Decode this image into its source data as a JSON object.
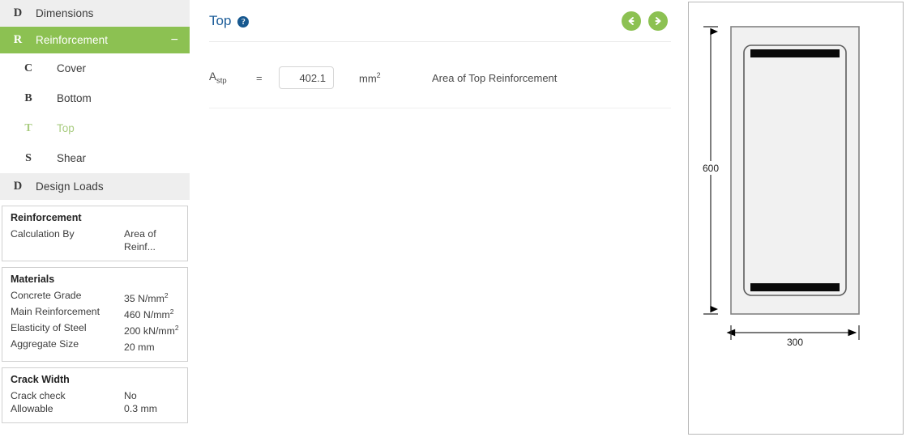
{
  "sidebar": {
    "sections": [
      {
        "letter": "D",
        "label": "Dimensions",
        "active": false,
        "collapse": ""
      },
      {
        "letter": "R",
        "label": "Reinforcement",
        "active": true,
        "collapse": "−"
      }
    ],
    "items": [
      {
        "letter": "C",
        "label": "Cover",
        "selected": false
      },
      {
        "letter": "B",
        "label": "Bottom",
        "selected": false
      },
      {
        "letter": "T",
        "label": "Top",
        "selected": true
      },
      {
        "letter": "S",
        "label": "Shear",
        "selected": false
      }
    ],
    "design_loads": {
      "letter": "D",
      "label": "Design Loads"
    },
    "panels": [
      {
        "title": "Reinforcement",
        "rows": [
          {
            "key": "Calculation By",
            "value": "Area of Reinf..."
          }
        ]
      },
      {
        "title": "Materials",
        "rows": [
          {
            "key": "Concrete Grade",
            "value": "35 N/mm",
            "sup": "2"
          },
          {
            "key": "Main Reinforcement",
            "value": "460 N/mm",
            "sup": "2"
          },
          {
            "key": "Elasticity of Steel",
            "value": "200 kN/mm",
            "sup": "2"
          },
          {
            "key": "Aggregate Size",
            "value": "20 mm",
            "sup": ""
          }
        ]
      },
      {
        "title": "Crack Width",
        "rows": [
          {
            "key": "Crack check",
            "value": "No",
            "sup": ""
          },
          {
            "key": "Allowable",
            "value": "0.3 mm",
            "sup": ""
          }
        ]
      }
    ]
  },
  "main": {
    "title": "Top",
    "help_label": "?",
    "prev_label": "Previous",
    "next_label": "Next",
    "field": {
      "symbol": "A",
      "symbol_sub": "stp",
      "equals": "=",
      "value": "402.1",
      "placeholder": "",
      "unit": "mm",
      "unit_sup": "2",
      "description": "Area of Top Reinforcement"
    }
  },
  "diagram": {
    "depth_label": "600",
    "width_label": "300"
  },
  "colors": {
    "accent_green": "#8cc152",
    "title_blue": "#1f5f9a",
    "section_gray": "#eeeeee",
    "selected_green": "#a9cc80"
  }
}
